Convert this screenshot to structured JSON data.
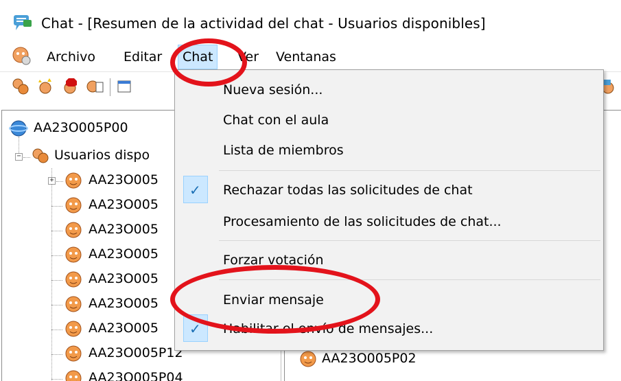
{
  "window": {
    "title": "Chat - [Resumen de la actividad del chat - Usuarios disponibles]"
  },
  "menubar": {
    "items": [
      {
        "label": "Archivo"
      },
      {
        "label": "Editar"
      },
      {
        "label": "Chat"
      },
      {
        "label": "Ver"
      },
      {
        "label": "Ventanas"
      }
    ]
  },
  "tree": {
    "root": "AA23O005P00",
    "group": "Usuarios dispo",
    "users": [
      "AA23O005",
      "AA23O005",
      "AA23O005",
      "AA23O005",
      "AA23O005",
      "AA23O005",
      "AA23O005",
      "AA23O005P12",
      "AA23O005P04"
    ]
  },
  "right_panel": {
    "visible_user": "AA23O005P02"
  },
  "chat_menu": {
    "items": [
      {
        "label": "Nueva sesión...",
        "checked": false
      },
      {
        "label": "Chat con el aula",
        "checked": false
      },
      {
        "label": "Lista de miembros",
        "checked": false
      },
      {
        "label": "Rechazar todas las solicitudes de chat",
        "checked": true
      },
      {
        "label": "Procesamiento de las solicitudes de chat...",
        "checked": false
      },
      {
        "label": "Forzar votación",
        "checked": false
      },
      {
        "label": "Enviar mensaje",
        "checked": false
      },
      {
        "label": "Habilitar el envío de mensajes...",
        "checked": true
      }
    ]
  },
  "colors": {
    "annotation_red": "#e3131b",
    "menu_highlight": "#cce8ff",
    "menu_bg": "#f2f2f2"
  }
}
